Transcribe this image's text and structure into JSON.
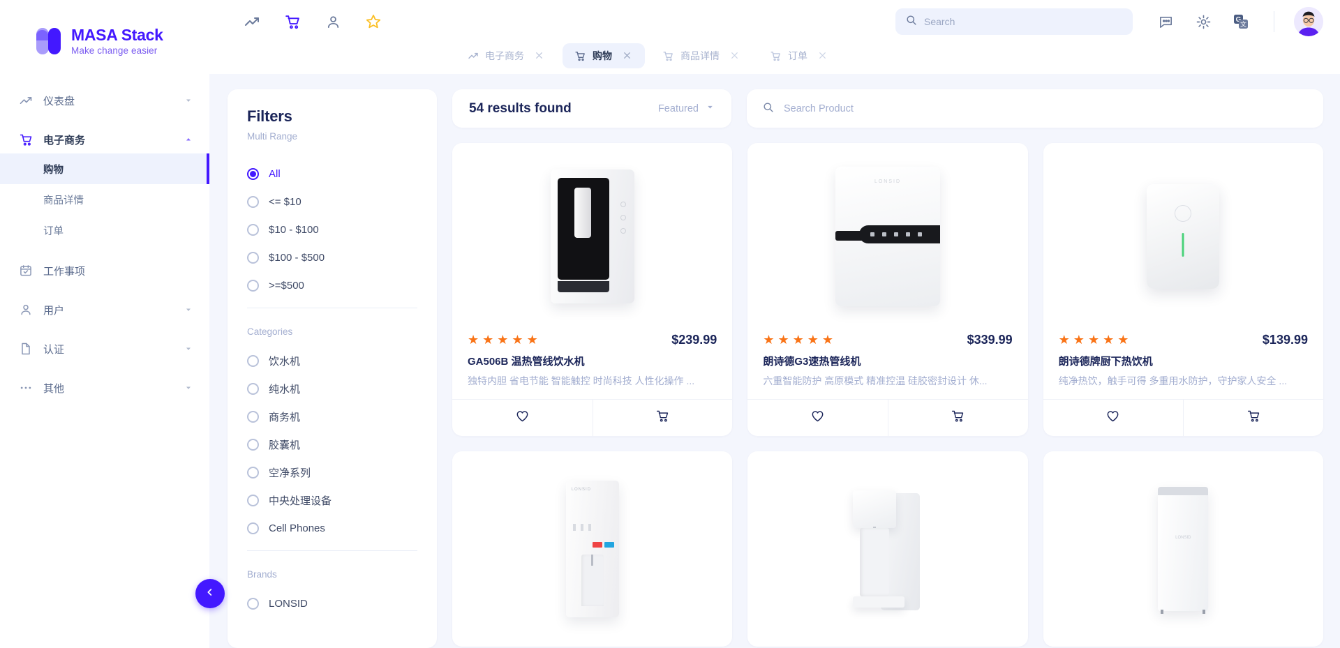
{
  "brand": {
    "title": "MASA Stack",
    "subtitle": "Make change easier"
  },
  "sidebar": {
    "items": [
      {
        "label": "仪表盘",
        "icon": "trending-up-icon",
        "caret": "down"
      },
      {
        "label": "电子商务",
        "icon": "cart-icon",
        "caret": "up",
        "open": true
      },
      {
        "label": "工作事项",
        "icon": "calendar-check-icon",
        "caret": "none"
      },
      {
        "label": "用户",
        "icon": "user-icon",
        "caret": "down"
      },
      {
        "label": "认证",
        "icon": "file-icon",
        "caret": "down"
      },
      {
        "label": "其他",
        "icon": "dots-icon",
        "caret": "down"
      }
    ],
    "subitems": [
      {
        "label": "购物",
        "active": true
      },
      {
        "label": "商品详情",
        "active": false
      },
      {
        "label": "订单",
        "active": false
      }
    ],
    "collapse_icon": "chevron-left-icon"
  },
  "topbar": {
    "icons": [
      "trending-up-icon",
      "cart-icon",
      "user-icon",
      "star-icon"
    ],
    "search": {
      "value": "",
      "placeholder": "Search",
      "icon": "search-icon"
    },
    "right_icons": [
      "chat-icon",
      "gear-icon",
      "translate-icon"
    ],
    "avatar": "avatar"
  },
  "tabs": [
    {
      "label": "电子商务",
      "icon": "trending-up-icon",
      "active": false,
      "close": "×"
    },
    {
      "label": "购物",
      "icon": "cart-icon",
      "active": true,
      "close": "×"
    },
    {
      "label": "商品详情",
      "icon": "cart-icon",
      "active": false,
      "close": "×"
    },
    {
      "label": "订单",
      "icon": "cart-icon",
      "active": false,
      "close": "×"
    }
  ],
  "filters": {
    "title": "Filters",
    "subtitle": "Multi Range",
    "price_ranges": [
      {
        "label": "All",
        "checked": true
      },
      {
        "label": "<= $10",
        "checked": false
      },
      {
        "label": "$10 - $100",
        "checked": false
      },
      {
        "label": "$100 - $500",
        "checked": false
      },
      {
        "label": ">=$500",
        "checked": false
      }
    ],
    "categories_title": "Categories",
    "categories": [
      {
        "label": "饮水机",
        "checked": false
      },
      {
        "label": "纯水机",
        "checked": false
      },
      {
        "label": "商务机",
        "checked": false
      },
      {
        "label": "胶囊机",
        "checked": false
      },
      {
        "label": "空净系列",
        "checked": false
      },
      {
        "label": "中央处理设备",
        "checked": false
      },
      {
        "label": "Cell Phones",
        "checked": false
      }
    ],
    "brands_title": "Brands",
    "brands": [
      {
        "label": "LONSID",
        "checked": false
      }
    ]
  },
  "results": {
    "count_label": "54 results found",
    "sort_label": "Featured",
    "sort_caret": "chevron-down-icon",
    "search": {
      "value": "",
      "placeholder": "Search Product",
      "icon": "search-icon"
    }
  },
  "products": [
    {
      "title": "GA506B 温热管线饮水机",
      "desc": "独特内胆 省电节能 智能触控 时尚科技 人性化操作 ...",
      "price": "$239.99",
      "stars": 5,
      "image": "water-dispenser-black-panel",
      "fav_icon": "heart-icon",
      "cart_icon": "cart-icon"
    },
    {
      "title": "朗诗德G3速热管线机",
      "desc": "六重智能防护 高原模式 精准控温 硅胶密封设计 休...",
      "price": "$339.99",
      "stars": 5,
      "image": "instant-heat-pipeline-machine",
      "fav_icon": "heart-icon",
      "cart_icon": "cart-icon"
    },
    {
      "title": "朗诗德牌厨下热饮机",
      "desc": "纯净热饮，触手可得 多重用水防护，守护家人安全 ...",
      "price": "$139.99",
      "stars": 5,
      "image": "under-sink-hot-water-unit",
      "fav_icon": "heart-icon",
      "cart_icon": "cart-icon"
    },
    {
      "image": "floor-standing-dispenser"
    },
    {
      "image": "tall-white-dispenser"
    },
    {
      "image": "slim-white-cabinet"
    }
  ],
  "colors": {
    "accent": "#4318FF",
    "star": "#f97316",
    "text_dark": "#1b2559",
    "text_muted": "#a3aed0",
    "bg": "#f4f6fd"
  }
}
